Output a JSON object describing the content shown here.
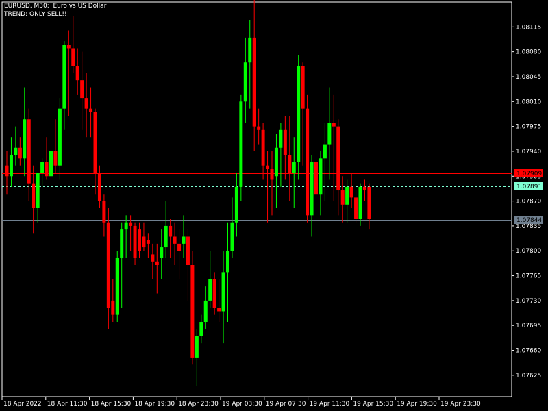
{
  "header": {
    "title": "EURUSD, M30:  Euro vs US Dollar",
    "trend": "TREND: ONLY SELL!!!"
  },
  "colors": {
    "background": "#000000",
    "frame": "#ffffff",
    "bull": "#00ff00",
    "bear": "#ff0000",
    "red_line": "#ff0000",
    "bid_line": "#7fffd4",
    "gray_line": "#708090",
    "text": "#ffffff"
  },
  "chart_data": {
    "type": "candlestick",
    "symbol": "EURUSD",
    "timeframe": "M30",
    "ylim": [
      1.07595,
      1.0815
    ],
    "y_ticks": [
      "1.08115",
      "1.08080",
      "1.08045",
      "1.08010",
      "1.07975",
      "1.07940",
      "1.07905",
      "1.07870",
      "1.07835",
      "1.07800",
      "1.07765",
      "1.07730",
      "1.07695",
      "1.07660",
      "1.07625"
    ],
    "x_ticks": [
      "18 Apr 2022",
      "18 Apr 11:30",
      "18 Apr 15:30",
      "18 Apr 19:30",
      "18 Apr 23:30",
      "19 Apr 03:30",
      "19 Apr 07:30",
      "19 Apr 11:30",
      "19 Apr 15:30",
      "19 Apr 19:30",
      "19 Apr 23:30"
    ],
    "price_lines": [
      {
        "name": "red-level",
        "price": 1.07909,
        "label": "1.07909",
        "style": "solid"
      },
      {
        "name": "bid",
        "price": 1.07891,
        "label": "1.07891",
        "style": "dashed"
      },
      {
        "name": "gray-level",
        "price": 1.07844,
        "label": "1.07844",
        "style": "solid"
      }
    ],
    "candles": [
      {
        "o": 1.0792,
        "h": 1.0794,
        "l": 1.0788,
        "c": 1.07905
      },
      {
        "o": 1.07905,
        "h": 1.0796,
        "l": 1.0789,
        "c": 1.07935
      },
      {
        "o": 1.07935,
        "h": 1.07975,
        "l": 1.0792,
        "c": 1.07945
      },
      {
        "o": 1.07945,
        "h": 1.0796,
        "l": 1.0792,
        "c": 1.0793
      },
      {
        "o": 1.0793,
        "h": 1.0803,
        "l": 1.07905,
        "c": 1.07985
      },
      {
        "o": 1.07985,
        "h": 1.08,
        "l": 1.0787,
        "c": 1.07895
      },
      {
        "o": 1.07895,
        "h": 1.0792,
        "l": 1.07825,
        "c": 1.0786
      },
      {
        "o": 1.0786,
        "h": 1.079,
        "l": 1.0784,
        "c": 1.0791
      },
      {
        "o": 1.0791,
        "h": 1.0793,
        "l": 1.0789,
        "c": 1.07925
      },
      {
        "o": 1.07925,
        "h": 1.0796,
        "l": 1.079,
        "c": 1.07905
      },
      {
        "o": 1.07905,
        "h": 1.07965,
        "l": 1.0789,
        "c": 1.0794
      },
      {
        "o": 1.0794,
        "h": 1.07985,
        "l": 1.0791,
        "c": 1.0792
      },
      {
        "o": 1.0792,
        "h": 1.08015,
        "l": 1.079,
        "c": 1.08
      },
      {
        "o": 1.08,
        "h": 1.08095,
        "l": 1.0797,
        "c": 1.0809
      },
      {
        "o": 1.0809,
        "h": 1.0811,
        "l": 1.0799,
        "c": 1.08085
      },
      {
        "o": 1.08085,
        "h": 1.0813,
        "l": 1.0805,
        "c": 1.0806
      },
      {
        "o": 1.0806,
        "h": 1.08085,
        "l": 1.0802,
        "c": 1.0804
      },
      {
        "o": 1.0804,
        "h": 1.0808,
        "l": 1.0797,
        "c": 1.08015
      },
      {
        "o": 1.08015,
        "h": 1.0805,
        "l": 1.0796,
        "c": 1.08
      },
      {
        "o": 1.08,
        "h": 1.0803,
        "l": 1.0796,
        "c": 1.07995
      },
      {
        "o": 1.07995,
        "h": 1.08,
        "l": 1.0788,
        "c": 1.0791
      },
      {
        "o": 1.0791,
        "h": 1.0792,
        "l": 1.0786,
        "c": 1.0787
      },
      {
        "o": 1.0787,
        "h": 1.0788,
        "l": 1.0782,
        "c": 1.0784
      },
      {
        "o": 1.0784,
        "h": 1.0786,
        "l": 1.0769,
        "c": 1.0772
      },
      {
        "o": 1.0773,
        "h": 1.0776,
        "l": 1.077,
        "c": 1.0771
      },
      {
        "o": 1.0771,
        "h": 1.078,
        "l": 1.077,
        "c": 1.0779
      },
      {
        "o": 1.0779,
        "h": 1.0784,
        "l": 1.0772,
        "c": 1.0783
      },
      {
        "o": 1.0783,
        "h": 1.0785,
        "l": 1.0779,
        "c": 1.0784
      },
      {
        "o": 1.0784,
        "h": 1.0785,
        "l": 1.078,
        "c": 1.07835
      },
      {
        "o": 1.07835,
        "h": 1.0784,
        "l": 1.0778,
        "c": 1.0779
      },
      {
        "o": 1.0783,
        "h": 1.0784,
        "l": 1.0779,
        "c": 1.078
      },
      {
        "o": 1.0782,
        "h": 1.0784,
        "l": 1.078,
        "c": 1.07805
      },
      {
        "o": 1.07815,
        "h": 1.07825,
        "l": 1.0779,
        "c": 1.0781
      },
      {
        "o": 1.07795,
        "h": 1.0781,
        "l": 1.0776,
        "c": 1.07785
      },
      {
        "o": 1.07785,
        "h": 1.0781,
        "l": 1.0774,
        "c": 1.0778
      },
      {
        "o": 1.0779,
        "h": 1.0783,
        "l": 1.0776,
        "c": 1.07805
      },
      {
        "o": 1.07805,
        "h": 1.0787,
        "l": 1.0779,
        "c": 1.07835
      },
      {
        "o": 1.07835,
        "h": 1.07845,
        "l": 1.0779,
        "c": 1.0782
      },
      {
        "o": 1.0782,
        "h": 1.0784,
        "l": 1.0778,
        "c": 1.0781
      },
      {
        "o": 1.0781,
        "h": 1.0783,
        "l": 1.0776,
        "c": 1.078
      },
      {
        "o": 1.0781,
        "h": 1.0785,
        "l": 1.0779,
        "c": 1.0782
      },
      {
        "o": 1.0782,
        "h": 1.0783,
        "l": 1.0773,
        "c": 1.0778
      },
      {
        "o": 1.0778,
        "h": 1.078,
        "l": 1.0764,
        "c": 1.0765
      },
      {
        "o": 1.0765,
        "h": 1.0769,
        "l": 1.0761,
        "c": 1.0768
      },
      {
        "o": 1.0768,
        "h": 1.0771,
        "l": 1.0767,
        "c": 1.077
      },
      {
        "o": 1.077,
        "h": 1.0775,
        "l": 1.0769,
        "c": 1.0773
      },
      {
        "o": 1.0773,
        "h": 1.078,
        "l": 1.0772,
        "c": 1.0776
      },
      {
        "o": 1.0776,
        "h": 1.0777,
        "l": 1.0771,
        "c": 1.0772
      },
      {
        "o": 1.0772,
        "h": 1.0776,
        "l": 1.077,
        "c": 1.07715
      },
      {
        "o": 1.07715,
        "h": 1.078,
        "l": 1.0767,
        "c": 1.0777
      },
      {
        "o": 1.0777,
        "h": 1.0784,
        "l": 1.077,
        "c": 1.078
      },
      {
        "o": 1.078,
        "h": 1.07875,
        "l": 1.0779,
        "c": 1.0784
      },
      {
        "o": 1.0784,
        "h": 1.0791,
        "l": 1.0782,
        "c": 1.0789
      },
      {
        "o": 1.0789,
        "h": 1.0802,
        "l": 1.0787,
        "c": 1.0801
      },
      {
        "o": 1.0801,
        "h": 1.081,
        "l": 1.0798,
        "c": 1.08065
      },
      {
        "o": 1.08065,
        "h": 1.08125,
        "l": 1.08,
        "c": 1.081
      },
      {
        "o": 1.081,
        "h": 1.08155,
        "l": 1.0794,
        "c": 1.07975
      },
      {
        "o": 1.07975,
        "h": 1.08,
        "l": 1.0795,
        "c": 1.0797
      },
      {
        "o": 1.0797,
        "h": 1.0798,
        "l": 1.079,
        "c": 1.0792
      },
      {
        "o": 1.0792,
        "h": 1.0794,
        "l": 1.0784,
        "c": 1.07915
      },
      {
        "o": 1.07915,
        "h": 1.0794,
        "l": 1.0785,
        "c": 1.079
      },
      {
        "o": 1.07905,
        "h": 1.07965,
        "l": 1.0786,
        "c": 1.07945
      },
      {
        "o": 1.07945,
        "h": 1.0798,
        "l": 1.0789,
        "c": 1.0797
      },
      {
        "o": 1.0797,
        "h": 1.0799,
        "l": 1.079,
        "c": 1.07935
      },
      {
        "o": 1.07935,
        "h": 1.0799,
        "l": 1.0787,
        "c": 1.0791
      },
      {
        "o": 1.0791,
        "h": 1.0796,
        "l": 1.0786,
        "c": 1.07925
      },
      {
        "o": 1.07925,
        "h": 1.08075,
        "l": 1.079,
        "c": 1.0806
      },
      {
        "o": 1.0806,
        "h": 1.08065,
        "l": 1.0792,
        "c": 1.08
      },
      {
        "o": 1.08,
        "h": 1.0802,
        "l": 1.0784,
        "c": 1.0785
      },
      {
        "o": 1.0785,
        "h": 1.07935,
        "l": 1.0782,
        "c": 1.07925
      },
      {
        "o": 1.07925,
        "h": 1.0795,
        "l": 1.0786,
        "c": 1.0788
      },
      {
        "o": 1.0788,
        "h": 1.0794,
        "l": 1.0785,
        "c": 1.0793
      },
      {
        "o": 1.0793,
        "h": 1.0798,
        "l": 1.0787,
        "c": 1.0795
      },
      {
        "o": 1.0795,
        "h": 1.0803,
        "l": 1.079,
        "c": 1.0798
      },
      {
        "o": 1.0798,
        "h": 1.0802,
        "l": 1.0787,
        "c": 1.07975
      },
      {
        "o": 1.07975,
        "h": 1.07985,
        "l": 1.0785,
        "c": 1.07885
      },
      {
        "o": 1.07885,
        "h": 1.07905,
        "l": 1.0784,
        "c": 1.07865
      },
      {
        "o": 1.07865,
        "h": 1.079,
        "l": 1.0784,
        "c": 1.0789
      },
      {
        "o": 1.0789,
        "h": 1.0791,
        "l": 1.0786,
        "c": 1.07875
      },
      {
        "o": 1.07875,
        "h": 1.07885,
        "l": 1.0784,
        "c": 1.07845
      },
      {
        "o": 1.07845,
        "h": 1.07895,
        "l": 1.07835,
        "c": 1.0789
      },
      {
        "o": 1.0789,
        "h": 1.079,
        "l": 1.0787,
        "c": 1.07885
      },
      {
        "o": 1.0789,
        "h": 1.07895,
        "l": 1.0783,
        "c": 1.07845
      }
    ]
  }
}
